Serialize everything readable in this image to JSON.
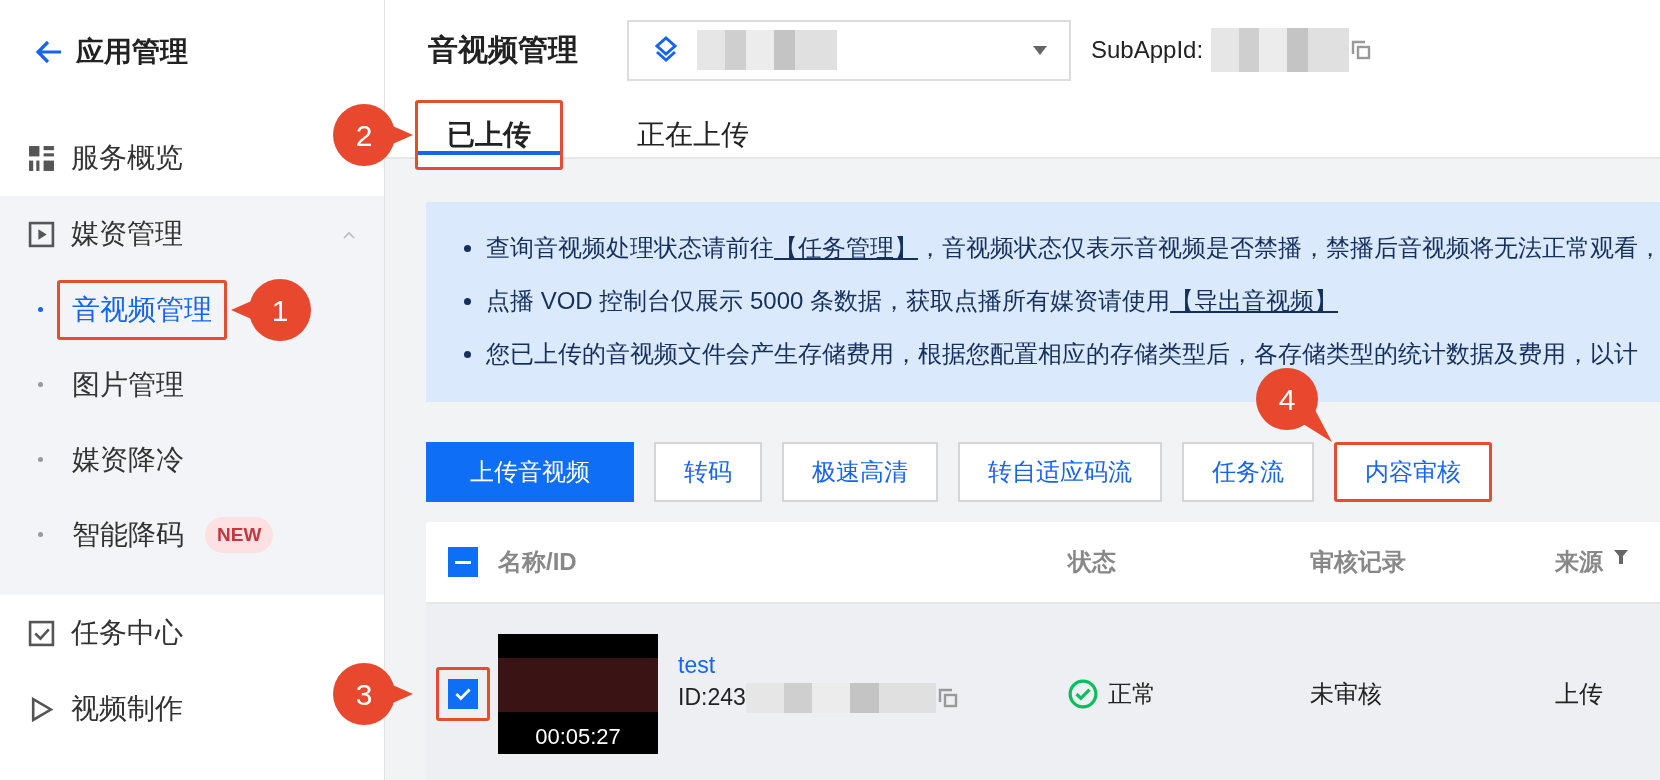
{
  "sidebar": {
    "back_title": "应用管理",
    "items": [
      {
        "label": "服务概览",
        "kind": "grid",
        "selected": false
      },
      {
        "label": "媒资管理",
        "kind": "play",
        "selected": false,
        "expanded": true,
        "children": [
          {
            "label": "音视频管理",
            "selected": true,
            "callout": "1"
          },
          {
            "label": "图片管理",
            "selected": false
          },
          {
            "label": "媒资降冷",
            "selected": false
          },
          {
            "label": "智能降码",
            "selected": false,
            "badge": "NEW"
          }
        ]
      },
      {
        "label": "任务中心",
        "kind": "check",
        "selected": false
      },
      {
        "label": "视频制作",
        "kind": "triangle",
        "selected": false
      }
    ]
  },
  "header": {
    "title": "音视频管理",
    "subappid_label": "SubAppId:"
  },
  "tabs": [
    {
      "label": "已上传",
      "selected": true,
      "callout": "2"
    },
    {
      "label": "正在上传",
      "selected": false
    }
  ],
  "notice": [
    {
      "before": "查询音视频处理状态请前往",
      "link": "【任务管理】",
      "after": "，音视频状态仅表示音视频是否禁播，禁播后音视频将无法正常观看，"
    },
    {
      "before": "点播 VOD 控制台仅展示 5000 条数据，获取点播所有媒资请使用",
      "link": "【导出音视频】"
    },
    {
      "before": "您已上传的音视频文件会产生存储费用，根据您配置相应的存储类型后，各存储类型的统计数据及费用，以计"
    }
  ],
  "toolbar": [
    {
      "label": "上传音视频",
      "primary": true
    },
    {
      "label": "转码",
      "primary": false
    },
    {
      "label": "极速高清",
      "primary": false
    },
    {
      "label": "转自适应码流",
      "primary": false
    },
    {
      "label": "任务流",
      "primary": false
    },
    {
      "label": "内容审核",
      "primary": false,
      "callout": "4"
    }
  ],
  "table": {
    "select_all_indeterminate": true,
    "columns": [
      {
        "label": "名称/ID"
      },
      {
        "label": "状态"
      },
      {
        "label": "审核记录"
      },
      {
        "label": "来源",
        "filter": true
      }
    ],
    "rows": [
      {
        "selected": true,
        "callout": "3",
        "duration": "00:05:27",
        "name": "test",
        "id": "ID:243",
        "status": "正常",
        "status_ok": true,
        "review": "未审核",
        "source": "上传"
      }
    ]
  }
}
